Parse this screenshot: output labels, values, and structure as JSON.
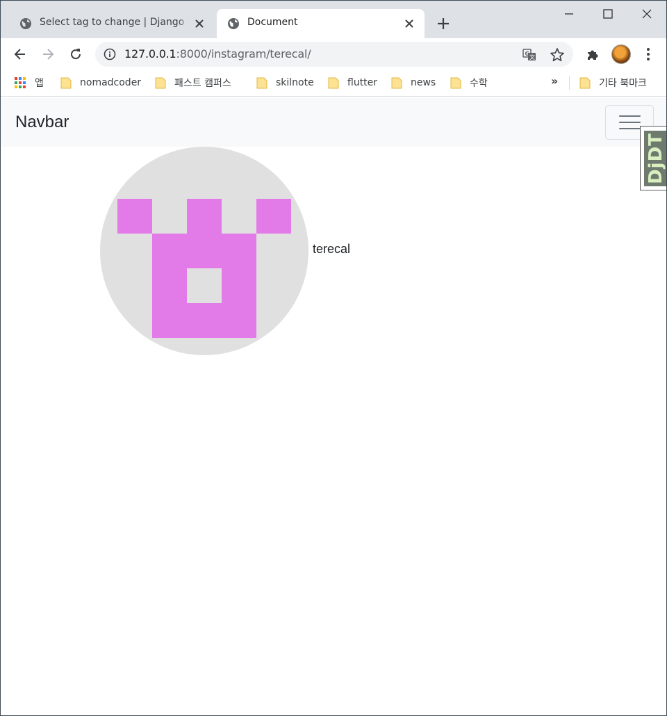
{
  "browser": {
    "tabs": [
      {
        "title": "Select tag to change | Django site admin",
        "active": false,
        "icon": "globe-icon"
      },
      {
        "title": "Document",
        "active": true,
        "icon": "globe-icon"
      }
    ],
    "new_tab_icon": "plus-icon",
    "window_controls": [
      "minimize-icon",
      "maximize-icon",
      "close-icon"
    ],
    "nav_icons": [
      "back-arrow-icon",
      "forward-arrow-icon",
      "reload-icon"
    ],
    "url_host": "127.0.0.1",
    "url_rest": ":8000/instagram/terecal/",
    "omnibox_icons": [
      "info-icon",
      "translate-icon",
      "star-icon"
    ],
    "toolbar_icons": [
      "extensions-icon",
      "profile-avatar",
      "menu-dots-icon"
    ],
    "bookmarks": [
      {
        "label": "앱",
        "icon": "apps-grid-icon"
      },
      {
        "label": "nomadcoder",
        "icon": "folder-icon"
      },
      {
        "label": "패스트 캠퍼스",
        "icon": "folder-icon"
      },
      {
        "label": "skilnote",
        "icon": "folder-icon"
      },
      {
        "label": "flutter",
        "icon": "folder-icon"
      },
      {
        "label": "news",
        "icon": "folder-icon"
      },
      {
        "label": "수학",
        "icon": "folder-icon"
      }
    ],
    "bookmarks_overflow": "»",
    "other_bookmarks": "기타 북마크"
  },
  "page": {
    "navbar_brand": "Navbar",
    "toggler_icon": "hamburger-icon",
    "debug_toolbar_handle": "DjDT",
    "profile": {
      "username": "terecal",
      "avatar_color": "#e27be8",
      "avatar_bg": "#e0e0e0"
    }
  },
  "colors": {
    "tabstrip": "#dee1e6",
    "navbar_bg": "#f8f9fa",
    "text": "#212529"
  }
}
